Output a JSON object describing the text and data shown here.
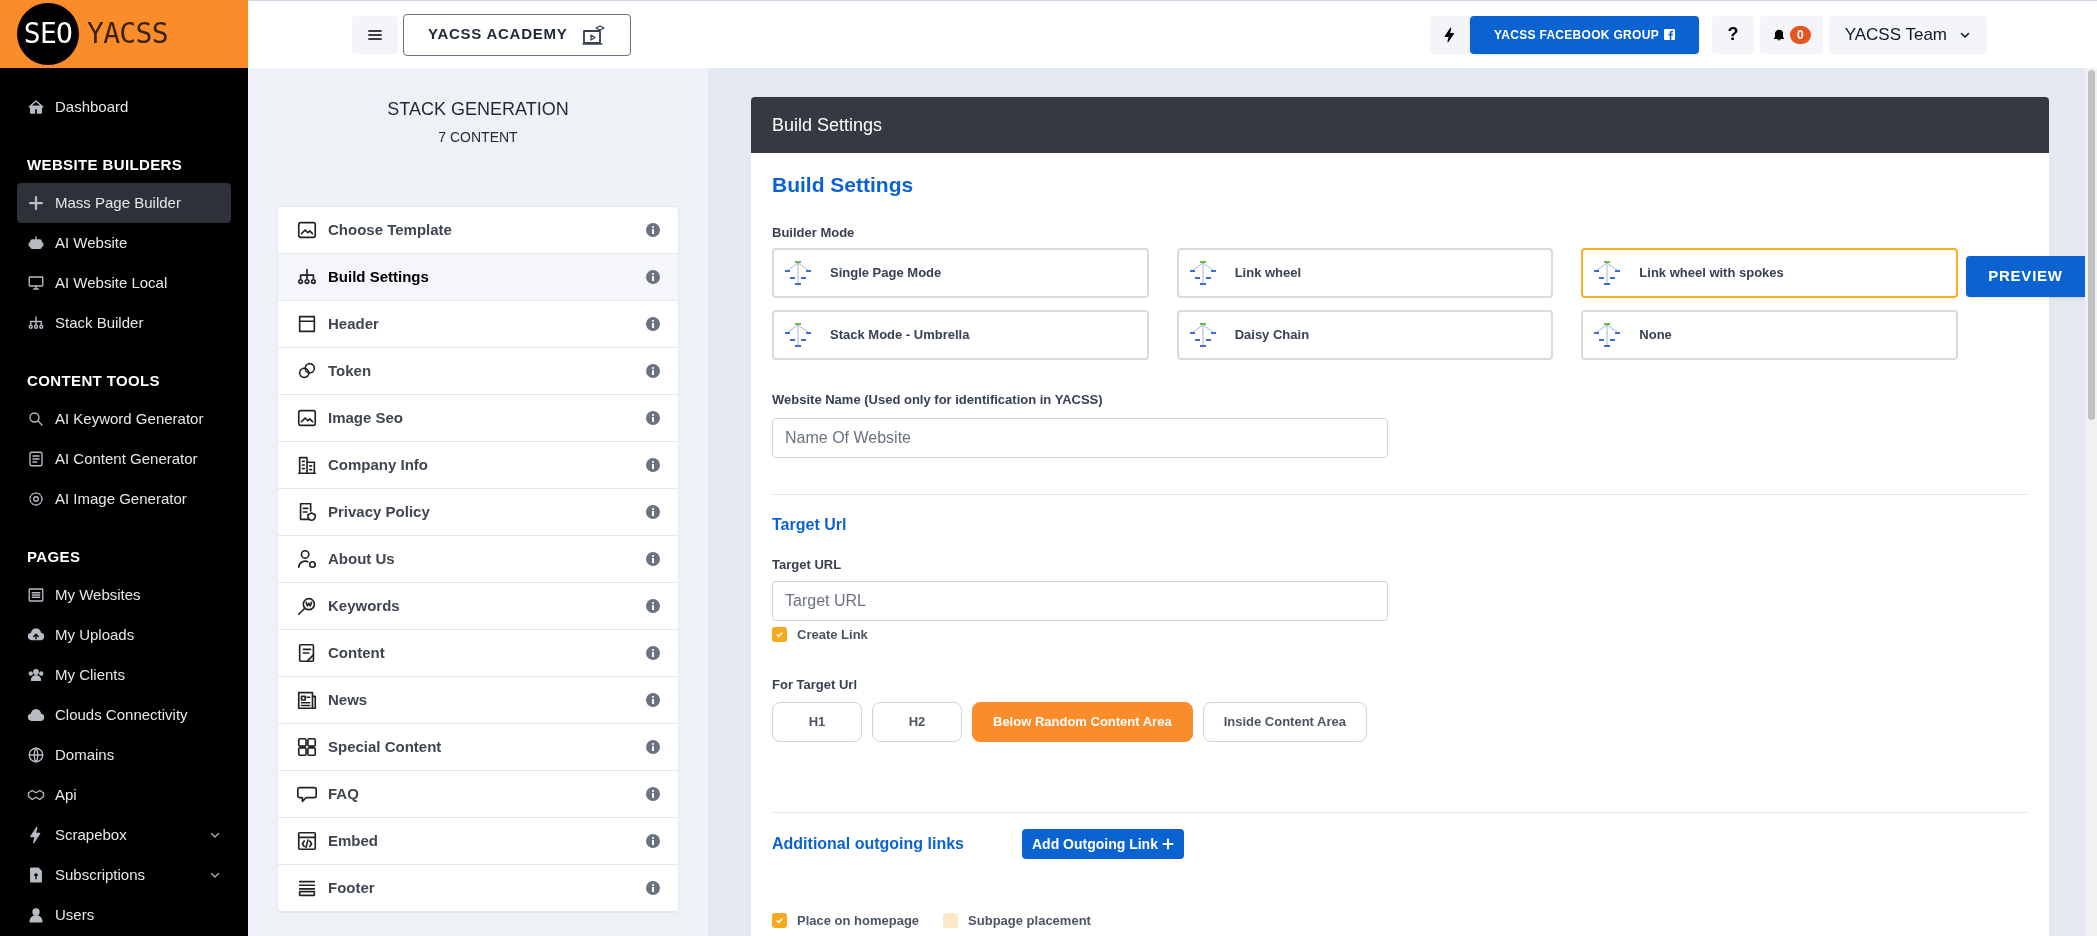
{
  "logo": {
    "badge": "SEO",
    "name": "YACSS"
  },
  "topbar": {
    "academy_button": "YACSS ACADEMY",
    "facebook_button": "YACSS FACEBOOK GROUP",
    "help_button": "?",
    "notifications": "0",
    "user_menu": "YACSS Team"
  },
  "sidebar": {
    "sections": [
      {
        "items": [
          {
            "label": "Dashboard",
            "kind": "link",
            "selected": false
          }
        ]
      },
      {
        "heading": "WEBSITE BUILDERS",
        "items": [
          {
            "label": "Mass Page Builder",
            "kind": "link",
            "selected": true
          },
          {
            "label": "AI Website",
            "kind": "link",
            "selected": false
          },
          {
            "label": "AI Website Local",
            "kind": "link",
            "selected": false
          },
          {
            "label": "Stack Builder",
            "kind": "link",
            "selected": false
          }
        ]
      },
      {
        "heading": "CONTENT TOOLS",
        "items": [
          {
            "label": "AI Keyword Generator",
            "kind": "link",
            "selected": false
          },
          {
            "label": "AI Content Generator",
            "kind": "link",
            "selected": false
          },
          {
            "label": "AI Image Generator",
            "kind": "link",
            "selected": false
          }
        ]
      },
      {
        "heading": "PAGES",
        "items": [
          {
            "label": "My Websites",
            "kind": "link",
            "selected": false
          },
          {
            "label": "My Uploads",
            "kind": "link",
            "selected": false
          },
          {
            "label": "My Clients",
            "kind": "link",
            "selected": false
          },
          {
            "label": "Clouds Connectivity",
            "kind": "link",
            "selected": false
          },
          {
            "label": "Domains",
            "kind": "link",
            "selected": false
          },
          {
            "label": "Api",
            "kind": "link",
            "selected": false
          },
          {
            "label": "Scrapebox",
            "kind": "submenu",
            "selected": false
          },
          {
            "label": "Subscriptions",
            "kind": "submenu",
            "selected": false
          },
          {
            "label": "Users",
            "kind": "link",
            "selected": false
          }
        ]
      }
    ]
  },
  "steps_panel": {
    "title": "STACK GENERATION",
    "subtitle": "7 CONTENT",
    "steps": [
      {
        "label": "Choose Template",
        "selected": false
      },
      {
        "label": "Build Settings",
        "selected": true
      },
      {
        "label": "Header",
        "selected": false
      },
      {
        "label": "Token",
        "selected": false
      },
      {
        "label": "Image Seo",
        "selected": false
      },
      {
        "label": "Company Info",
        "selected": false
      },
      {
        "label": "Privacy Policy",
        "selected": false
      },
      {
        "label": "About Us",
        "selected": false
      },
      {
        "label": "Keywords",
        "selected": false
      },
      {
        "label": "Content",
        "selected": false
      },
      {
        "label": "News",
        "selected": false
      },
      {
        "label": "Special Content",
        "selected": false
      },
      {
        "label": "FAQ",
        "selected": false
      },
      {
        "label": "Embed",
        "selected": false
      },
      {
        "label": "Footer",
        "selected": false
      }
    ]
  },
  "card": {
    "header": "Build Settings",
    "title": "Build Settings",
    "builder_mode_label": "Builder Mode",
    "builder_modes": [
      {
        "label": "Single Page Mode",
        "selected": false
      },
      {
        "label": "Link wheel",
        "selected": false
      },
      {
        "label": "Link wheel with spokes",
        "selected": true
      },
      {
        "label": "Stack Mode - Umbrella",
        "selected": false
      },
      {
        "label": "Daisy Chain",
        "selected": false
      },
      {
        "label": "None",
        "selected": false
      }
    ],
    "preview_button": "PREVIEW",
    "website_name_label": "Website Name (Used only for identification in YACSS)",
    "website_name_placeholder": "Name Of Website",
    "target_section_title": "Target Url",
    "target_url_label": "Target URL",
    "target_url_placeholder": "Target URL",
    "create_link": {
      "label": "Create Link",
      "checked": true
    },
    "for_target_label": "For Target Url",
    "placements": [
      {
        "label": "H1",
        "selected": false
      },
      {
        "label": "H2",
        "selected": false
      },
      {
        "label": "Below Random Content Area",
        "selected": true
      },
      {
        "label": "Inside Content Area",
        "selected": false
      }
    ],
    "outgoing_title": "Additional outgoing links",
    "add_outgoing_button": "Add Outgoing Link",
    "placement_options": [
      {
        "label": "Place on homepage",
        "checked": true
      },
      {
        "label": "Subpage placement",
        "checked": false
      }
    ]
  }
}
